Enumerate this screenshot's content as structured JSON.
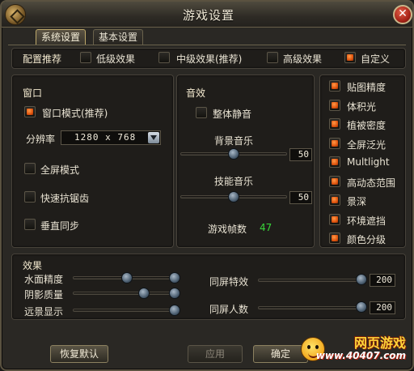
{
  "window": {
    "title": "游戏设置",
    "close_icon": "close-icon"
  },
  "tabs": [
    {
      "label": "系统设置",
      "active": true
    },
    {
      "label": "基本设置",
      "active": false
    }
  ],
  "presets": {
    "label": "配置推荐",
    "options": [
      {
        "label": "低级效果",
        "checked": false
      },
      {
        "label": "中级效果(推荐)",
        "checked": false
      },
      {
        "label": "高级效果",
        "checked": false
      },
      {
        "label": "自定义",
        "checked": true
      }
    ]
  },
  "window_section": {
    "title": "窗口",
    "window_mode": {
      "label": "窗口模式(推荐)",
      "checked": true
    },
    "resolution": {
      "label": "分辨率",
      "value": "1280 x 768"
    },
    "fullscreen": {
      "label": "全屏模式",
      "checked": false
    },
    "antialias": {
      "label": "快速抗锯齿",
      "checked": false
    },
    "vsync": {
      "label": "垂直同步",
      "checked": false
    }
  },
  "sound": {
    "title": "音效",
    "mute_all": {
      "label": "整体静音",
      "checked": false
    },
    "bgm": {
      "label": "背景音乐",
      "value": "50",
      "level": 0.5
    },
    "skill": {
      "label": "技能音乐",
      "value": "50",
      "level": 0.5
    },
    "fps_label": "游戏帧数",
    "fps_value": "47"
  },
  "graphics_options": [
    {
      "label": "贴图精度",
      "checked": true
    },
    {
      "label": "体积光",
      "checked": true
    },
    {
      "label": "植被密度",
      "checked": true
    },
    {
      "label": "全屏泛光",
      "checked": true
    },
    {
      "label": "Multlight",
      "checked": true
    },
    {
      "label": "高动态范围",
      "checked": true
    },
    {
      "label": "景深",
      "checked": true
    },
    {
      "label": "环境遮挡",
      "checked": true
    },
    {
      "label": "颜色分级",
      "checked": true
    }
  ],
  "effects": {
    "title": "效果",
    "water": {
      "label": "水面精度",
      "level": 0.5
    },
    "shadow": {
      "label": "阴影质量",
      "level": 0.75
    },
    "distance": {
      "label": "远景显示",
      "level": 1.0
    },
    "same_screen_effects": {
      "label": "同屏特效",
      "value": "200",
      "level": 1.0
    },
    "same_screen_players": {
      "label": "同屏人数",
      "value": "200",
      "level": 1.0
    }
  },
  "buttons": {
    "restore_default": "恢复默认",
    "apply": "应用",
    "confirm": "确定"
  },
  "watermark": {
    "line1": "网页游戏",
    "line2": "www.40407.com"
  }
}
